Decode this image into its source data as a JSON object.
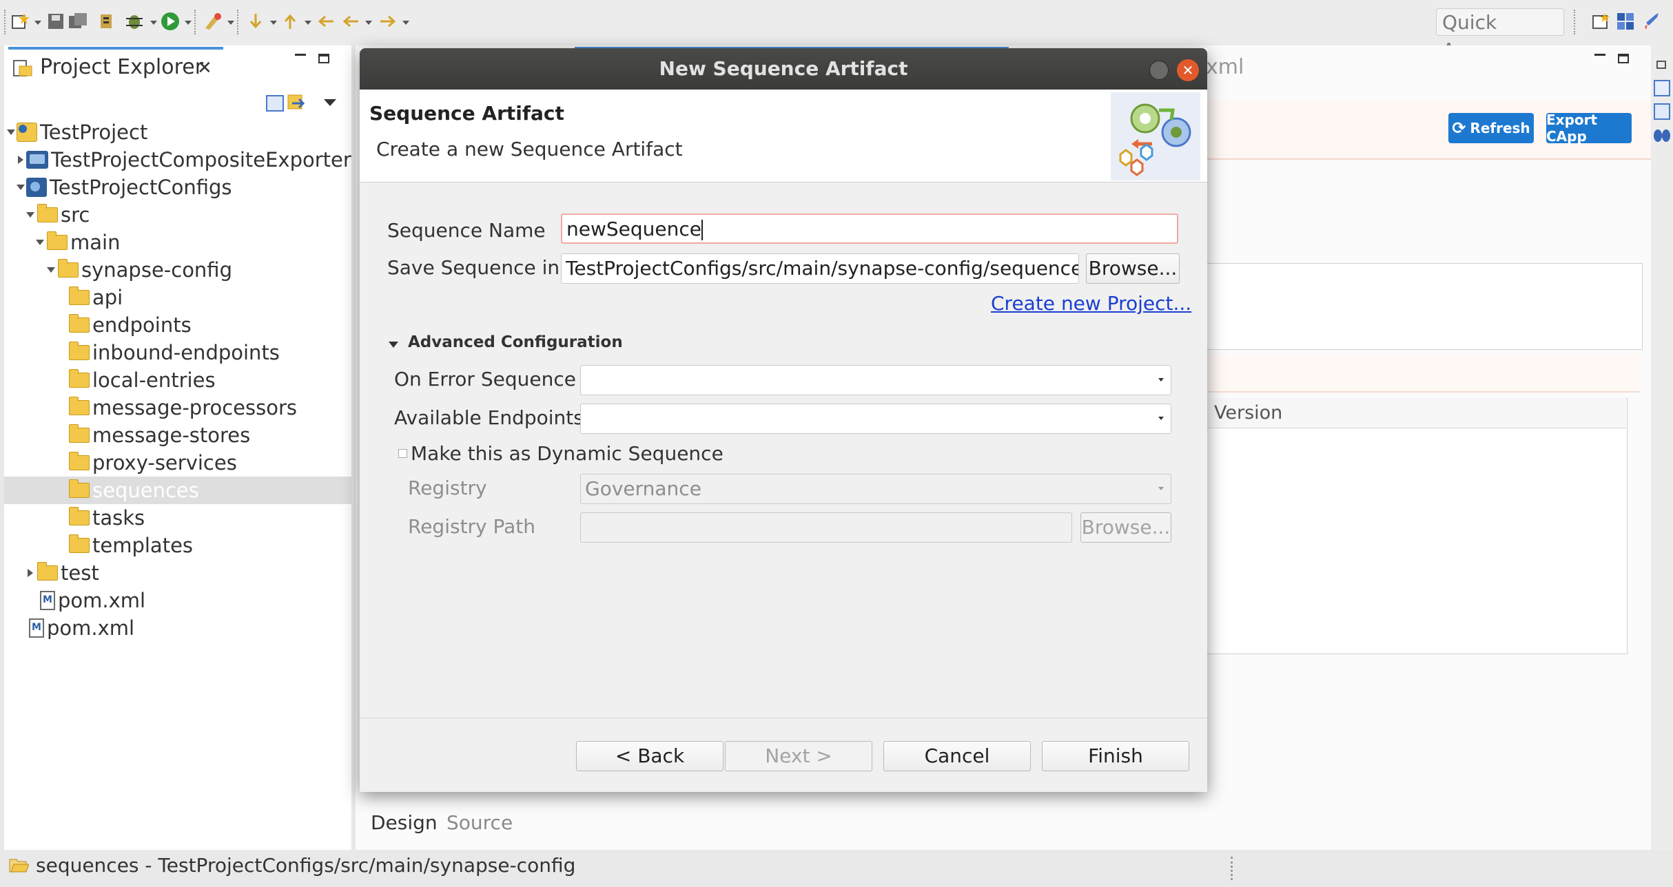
{
  "toolbar": {
    "quick_access_placeholder": "Quick Access"
  },
  "explorer": {
    "title": "Project Explorer",
    "tree": [
      {
        "label": "TestProject"
      },
      {
        "label": "TestProjectCompositeExporter"
      },
      {
        "label": "TestProjectConfigs"
      },
      {
        "label": "src"
      },
      {
        "label": "main"
      },
      {
        "label": "synapse-config"
      },
      {
        "label": "api"
      },
      {
        "label": "endpoints"
      },
      {
        "label": "inbound-endpoints"
      },
      {
        "label": "local-entries"
      },
      {
        "label": "message-processors"
      },
      {
        "label": "message-stores"
      },
      {
        "label": "proxy-services"
      },
      {
        "label": "sequences"
      },
      {
        "label": "tasks"
      },
      {
        "label": "templates"
      },
      {
        "label": "test"
      },
      {
        "label": "pom.xml"
      },
      {
        "label": "pom.xml"
      }
    ]
  },
  "editor": {
    "tab_partial": "xml",
    "refresh_label": "Refresh",
    "export_capp_label": "Export CApp",
    "version_header": "Version",
    "bottom_tabs": [
      "Design",
      "Source"
    ]
  },
  "dialog": {
    "title": "New Sequence Artifact",
    "header_title": "Sequence Artifact",
    "header_description": "Create a new Sequence Artifact",
    "fields": {
      "sequence_name_label": "Sequence Name",
      "sequence_name_value": "newSequence",
      "save_in_label": "Save Sequence in:",
      "save_in_value": "TestProjectConfigs/src/main/synapse-config/sequences",
      "browse_label": "Browse...",
      "create_project_link": "Create new Project..."
    },
    "advanced": {
      "title": "Advanced Configuration",
      "on_error_label": "On Error Sequence",
      "on_error_value": "",
      "endpoints_label": "Available Endpoints",
      "endpoints_value": "",
      "dynamic_label": "Make this as Dynamic Sequence",
      "registry_label": "Registry",
      "registry_value": "Governance",
      "registry_path_label": "Registry Path",
      "registry_path_value": "",
      "registry_browse_label": "Browse..."
    },
    "buttons": {
      "back": "< Back",
      "next": "Next >",
      "cancel": "Cancel",
      "finish": "Finish"
    }
  },
  "statusbar": {
    "text": "sequences - TestProjectConfigs/src/main/synapse-config"
  },
  "colors": {
    "accent_blue": "#1d79d0",
    "close_orange": "#e25a2b",
    "link_blue": "#1a3fd1"
  }
}
